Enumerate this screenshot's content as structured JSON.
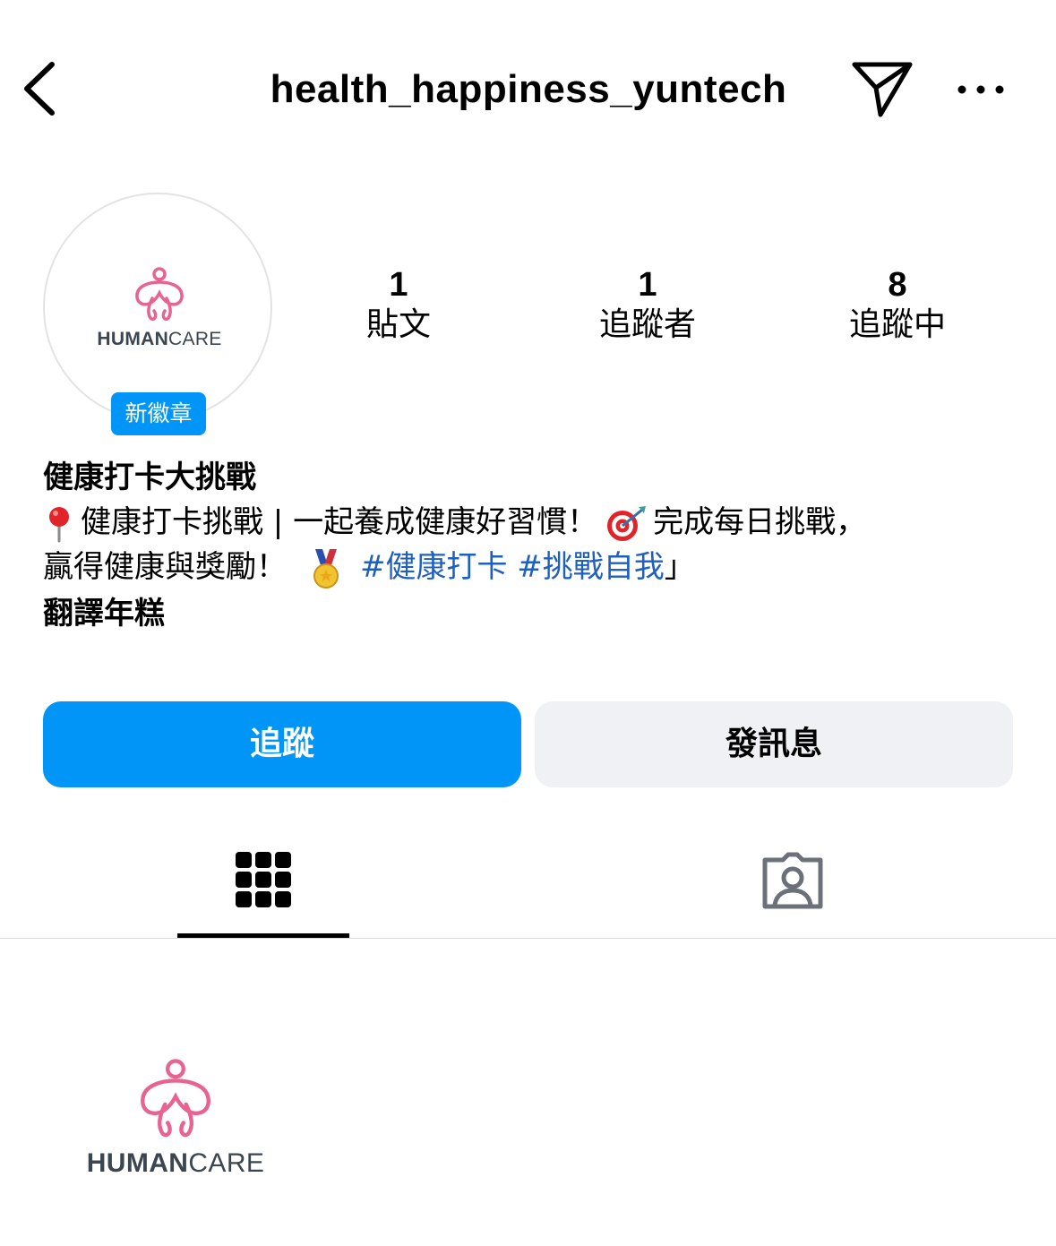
{
  "header": {
    "title": "health_happiness_yuntech",
    "back_icon": "chevron-left-icon",
    "dm_icon": "paper-plane-icon",
    "more_icon": "more-horizontal-icon"
  },
  "profile": {
    "avatar_logo_strong": "HUMAN",
    "avatar_logo_light": "CARE",
    "badge_label": "新徽章"
  },
  "stats": [
    {
      "value": "1",
      "label": "貼文"
    },
    {
      "value": "1",
      "label": "追蹤者"
    },
    {
      "value": "8",
      "label": "追蹤中"
    }
  ],
  "bio": {
    "name": "健康打卡大挑戰",
    "line1_part1": "健康打卡挑戰 | 一起養成健康好習慣！",
    "line1_part2": "完成每日挑戰，",
    "line2_part1": "贏得健康與獎勵！",
    "hashtags": "#健康打卡 #挑戰自我",
    "line2_end": "」",
    "translate": "翻譯年糕",
    "emojis": [
      "pushpin-icon",
      "target-icon",
      "medal-icon"
    ]
  },
  "actions": {
    "follow_label": "追蹤",
    "message_label": "發訊息"
  },
  "tabs": [
    {
      "icon": "grid-icon",
      "active": true
    },
    {
      "icon": "tagged-person-icon",
      "active": false
    }
  ],
  "post": {
    "logo_strong": "HUMAN",
    "logo_light": "CARE"
  },
  "colors": {
    "accent": "#0095f6",
    "hashtag": "#1f5fc0",
    "secondary_button": "#f0f1f4",
    "logo_pink": "#e8638f",
    "logo_text": "#3b4651"
  }
}
